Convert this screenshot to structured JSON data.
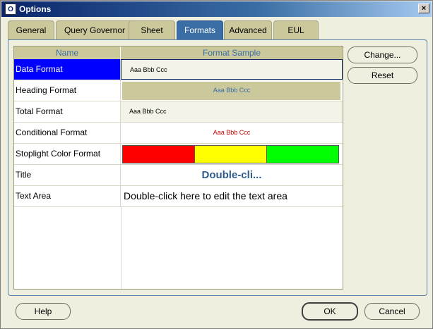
{
  "window": {
    "title": "Options",
    "app_icon": "O",
    "close_glyph": "×"
  },
  "tabs": [
    {
      "label": "General",
      "active": false
    },
    {
      "label": "Query Governor",
      "active": false
    },
    {
      "label": "Sheet",
      "active": false
    },
    {
      "label": "Formats",
      "active": true
    },
    {
      "label": "Advanced",
      "active": false
    },
    {
      "label": "EUL",
      "active": false
    }
  ],
  "grid": {
    "columns": [
      "Name",
      "Format Sample"
    ],
    "rows": [
      {
        "name": "Data Format",
        "sample": "Aaa Bbb Ccc",
        "selected": true
      },
      {
        "name": "Heading Format",
        "sample": "Aaa Bbb Ccc"
      },
      {
        "name": "Total Format",
        "sample": "Aaa Bbb Ccc"
      },
      {
        "name": "Conditional Format",
        "sample": "Aaa Bbb Ccc"
      },
      {
        "name": "Stoplight Color Format",
        "sample": ""
      },
      {
        "name": "Title",
        "sample": "Double-cli..."
      },
      {
        "name": "Text Area",
        "sample": "Double-click here to edit the text area"
      }
    ]
  },
  "stoplight_colors": [
    "#ff0000",
    "#ffff00",
    "#00ff00"
  ],
  "colors": {
    "accent": "#3a6ea5",
    "selection": "#0000ff",
    "heading_bg": "#cbc89c",
    "conditional_text": "#cc0000",
    "title_text": "#2f5c8a"
  },
  "buttons": {
    "change": "Change...",
    "reset": "Reset",
    "help": "Help",
    "ok": "OK",
    "cancel": "Cancel"
  }
}
